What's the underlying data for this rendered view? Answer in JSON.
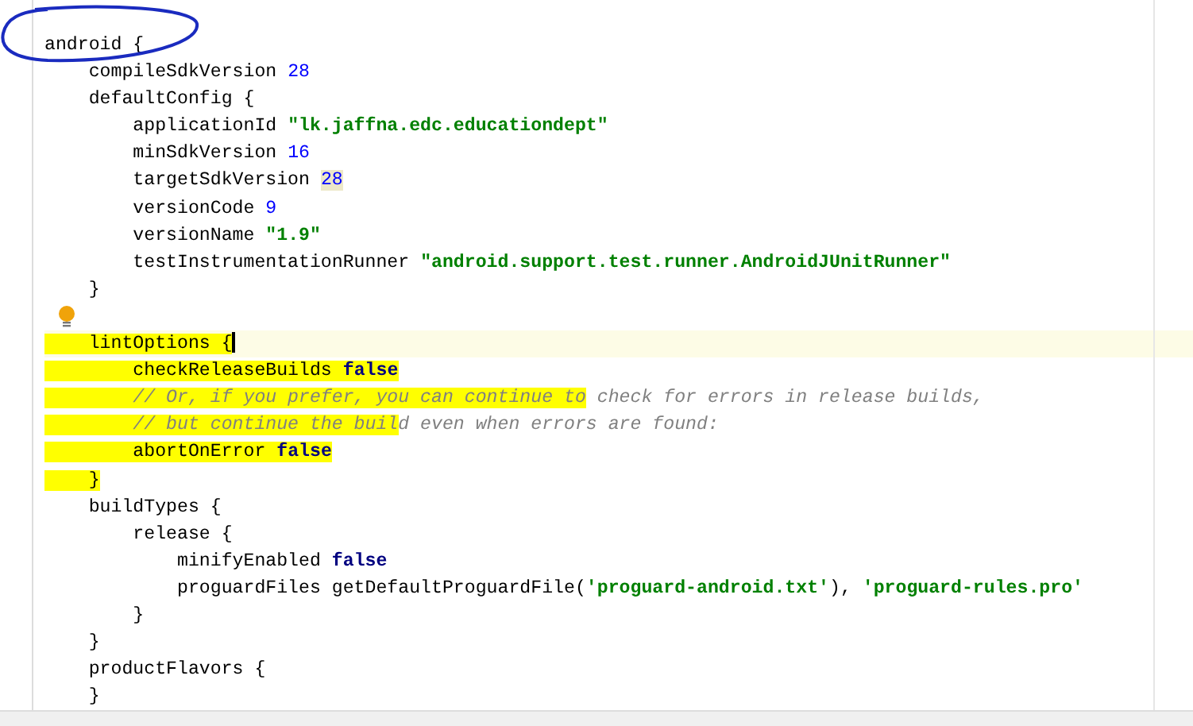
{
  "editor": {
    "lines": [
      {
        "current": false,
        "tokens": [
          {
            "kind": "plain",
            "text": "android {"
          }
        ]
      },
      {
        "current": false,
        "tokens": [
          {
            "kind": "plain",
            "text": "    compileSdkVersion "
          },
          {
            "kind": "number",
            "text": "28"
          }
        ]
      },
      {
        "current": false,
        "tokens": [
          {
            "kind": "plain",
            "text": "    defaultConfig {"
          }
        ]
      },
      {
        "current": false,
        "tokens": [
          {
            "kind": "plain",
            "text": "        applicationId "
          },
          {
            "kind": "string",
            "text": "\"lk.jaffna.edc.educationdept\""
          }
        ]
      },
      {
        "current": false,
        "tokens": [
          {
            "kind": "plain",
            "text": "        minSdkVersion "
          },
          {
            "kind": "number",
            "text": "16"
          }
        ]
      },
      {
        "current": false,
        "tokens": [
          {
            "kind": "plain",
            "text": "        targetSdkVersion "
          },
          {
            "kind": "number",
            "text": "28",
            "usage": true
          }
        ]
      },
      {
        "current": false,
        "tokens": [
          {
            "kind": "plain",
            "text": "        versionCode "
          },
          {
            "kind": "number",
            "text": "9"
          }
        ]
      },
      {
        "current": false,
        "tokens": [
          {
            "kind": "plain",
            "text": "        versionName "
          },
          {
            "kind": "string",
            "text": "\"1.9\""
          }
        ]
      },
      {
        "current": false,
        "tokens": [
          {
            "kind": "plain",
            "text": "        testInstrumentationRunner "
          },
          {
            "kind": "string",
            "text": "\"android.support.test.runner.AndroidJUnitRunner\""
          }
        ]
      },
      {
        "current": false,
        "tokens": [
          {
            "kind": "plain",
            "text": "    }"
          }
        ]
      },
      {
        "current": false,
        "bulb": true
      },
      {
        "current": true,
        "tokens": [
          {
            "kind": "plain",
            "text": "    lintOptions {",
            "highlighted": true
          }
        ]
      },
      {
        "current": false,
        "tokens": [
          {
            "kind": "plain",
            "text": "        checkReleaseBuilds ",
            "highlighted": true
          },
          {
            "kind": "keyword",
            "text": "false",
            "highlighted": true
          }
        ]
      },
      {
        "current": false,
        "tokens": [
          {
            "kind": "comment",
            "text": "        // Or, if you prefer, you can continue to",
            "highlighted": true
          },
          {
            "kind": "comment",
            "text": " check for errors in release builds,"
          }
        ]
      },
      {
        "current": false,
        "tokens": [
          {
            "kind": "comment",
            "text": "        // but continue the buil",
            "highlighted": true
          },
          {
            "kind": "comment",
            "text": "d even when errors are found:"
          }
        ]
      },
      {
        "current": false,
        "tokens": [
          {
            "kind": "plain",
            "text": "        abortOnError ",
            "highlighted": true
          },
          {
            "kind": "keyword",
            "text": "false",
            "highlighted": true
          }
        ]
      },
      {
        "current": false,
        "tokens": [
          {
            "kind": "plain",
            "text": "    }",
            "highlighted": true
          }
        ]
      },
      {
        "current": false,
        "tokens": [
          {
            "kind": "plain",
            "text": "    buildTypes {"
          }
        ]
      },
      {
        "current": false,
        "tokens": [
          {
            "kind": "plain",
            "text": "        release {"
          }
        ]
      },
      {
        "current": false,
        "tokens": [
          {
            "kind": "plain",
            "text": "            minifyEnabled "
          },
          {
            "kind": "keyword",
            "text": "false"
          }
        ]
      },
      {
        "current": false,
        "tokens": [
          {
            "kind": "plain",
            "text": "            proguardFiles getDefaultProguardFile("
          },
          {
            "kind": "string",
            "text": "'proguard-android.txt'"
          },
          {
            "kind": "plain",
            "text": "), "
          },
          {
            "kind": "string",
            "text": "'proguard-rules.pro'"
          }
        ]
      },
      {
        "current": false,
        "tokens": [
          {
            "kind": "plain",
            "text": "        }"
          }
        ]
      },
      {
        "current": false,
        "tokens": [
          {
            "kind": "plain",
            "text": "    }"
          }
        ]
      },
      {
        "current": false,
        "tokens": [
          {
            "kind": "plain",
            "text": "    productFlavors {"
          }
        ]
      },
      {
        "current": false,
        "tokens": [
          {
            "kind": "plain",
            "text": "    }"
          }
        ]
      }
    ]
  }
}
